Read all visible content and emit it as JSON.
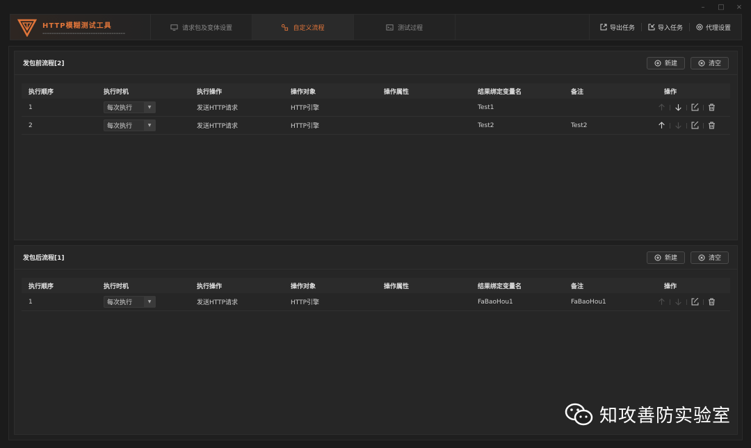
{
  "window": {
    "minimize": "–",
    "maximize": "□",
    "close": "×"
  },
  "header": {
    "app_title": "HTTP模糊测试工具",
    "tabs": [
      {
        "label": "请求包及变体设置",
        "icon": "monitor-icon"
      },
      {
        "label": "自定义流程",
        "icon": "flow-icon"
      },
      {
        "label": "测试过程",
        "icon": "terminal-icon"
      }
    ],
    "actions": [
      {
        "label": "导出任务",
        "icon": "export-icon"
      },
      {
        "label": "导入任务",
        "icon": "import-icon"
      },
      {
        "label": "代理设置",
        "icon": "proxy-icon"
      }
    ]
  },
  "colors": {
    "accent": "#e0753a",
    "background": "#1b1b1b",
    "panel": "#262626"
  },
  "columns": [
    "执行顺序",
    "执行时机",
    "执行操作",
    "操作对象",
    "操作属性",
    "结果绑定变量名",
    "备注",
    "操作"
  ],
  "pre_flow": {
    "title": "发包前流程[2]",
    "new_label": "新建",
    "clear_label": "清空",
    "rows": [
      {
        "order": "1",
        "timing": "每次执行",
        "action": "发送HTTP请求",
        "target": "HTTP引擎",
        "attr": "",
        "var": "Test1",
        "note": ""
      },
      {
        "order": "2",
        "timing": "每次执行",
        "action": "发送HTTP请求",
        "target": "HTTP引擎",
        "attr": "",
        "var": "Test2",
        "note": "Test2"
      }
    ]
  },
  "post_flow": {
    "title": "发包后流程[1]",
    "new_label": "新建",
    "clear_label": "清空",
    "rows": [
      {
        "order": "1",
        "timing": "每次执行",
        "action": "发送HTTP请求",
        "target": "HTTP引擎",
        "attr": "",
        "var": "FaBaoHou1",
        "note": "FaBaoHou1"
      }
    ]
  },
  "watermark": {
    "text": "知攻善防实验室",
    "icon": "wechat-icon"
  }
}
